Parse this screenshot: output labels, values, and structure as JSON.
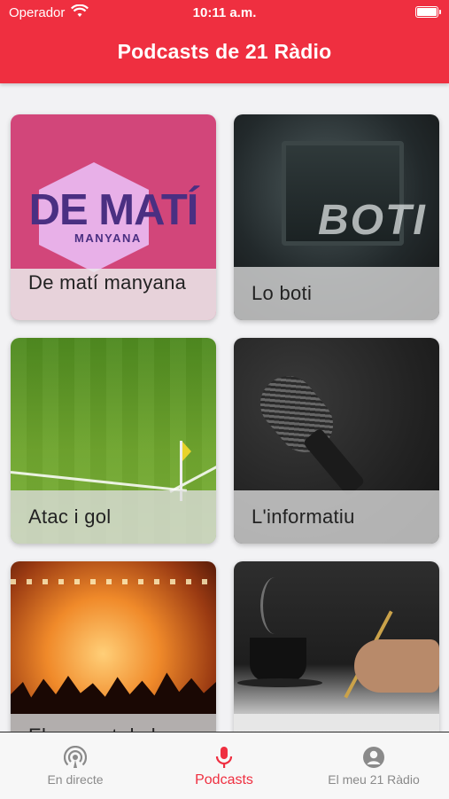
{
  "status_bar": {
    "carrier": "Operador",
    "time": "10:11 a.m."
  },
  "header": {
    "title": "Podcasts de 21 Ràdio"
  },
  "podcasts": [
    {
      "title": "De matí manyana",
      "art_logo_main": "DE MATÍ",
      "art_logo_sub": "MANYANA"
    },
    {
      "title": "Lo boti",
      "art_logo_main": "BOTI"
    },
    {
      "title": "Atac i gol"
    },
    {
      "title": "L'informatiu"
    },
    {
      "title": "El concert de la"
    },
    {
      "title": ""
    }
  ],
  "tabbar": {
    "items": [
      {
        "label": "En directe",
        "icon": "broadcast-icon",
        "active": false
      },
      {
        "label": "Podcasts",
        "icon": "microphone-icon",
        "active": true
      },
      {
        "label": "El meu 21 Ràdio",
        "icon": "user-account-icon",
        "active": false
      }
    ]
  },
  "colors": {
    "brand_red": "#ef2f40",
    "inactive_gray": "#8a8a8a"
  }
}
